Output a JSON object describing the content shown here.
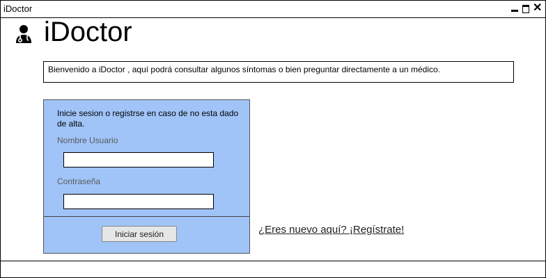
{
  "window": {
    "title": "iDoctor"
  },
  "header": {
    "logo_icon": "doctor-icon",
    "app_title": "iDoctor"
  },
  "welcome": {
    "text": "Bienvenido a iDoctor , aquí podrá consultar algunos síntomas o bien preguntar directamente a un médico."
  },
  "login": {
    "intro": "Inicie sesion o registrse en caso de no esta dado de alta.",
    "username_label": "Nombre Usuario",
    "username_value": "",
    "password_label": "Contraseña",
    "password_value": "",
    "submit_label": "Iniciar sesión",
    "panel_color": "#a0c4f8"
  },
  "register": {
    "link_text": "¿Eres nuevo aquí? ¡Regístrate!"
  }
}
